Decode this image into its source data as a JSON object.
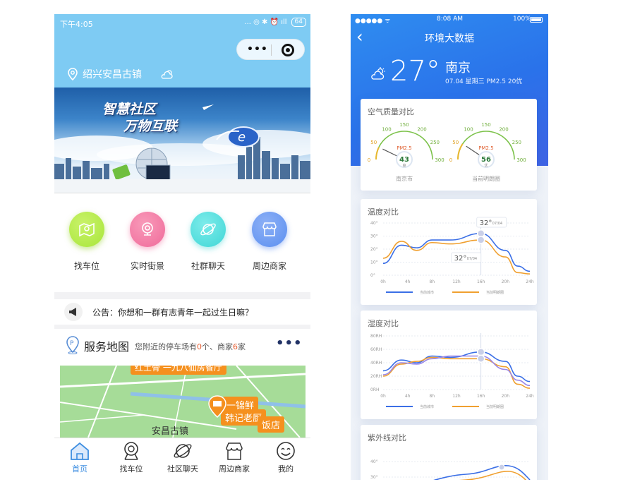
{
  "left": {
    "status": {
      "time": "下午4:05",
      "icons": "... ◎ ✱ ⏰ ıll",
      "battery": "64"
    },
    "location": "绍兴安昌古镇",
    "banner": {
      "line1": "智慧社区",
      "line2": "万物互联"
    },
    "services": [
      {
        "label": "找车位",
        "icon": "map-pin-icon",
        "color": "#a8e63a"
      },
      {
        "label": "实时街景",
        "icon": "camera-icon",
        "color": "#f06a9a"
      },
      {
        "label": "社群聊天",
        "icon": "planet-icon",
        "color": "#3fd7d6"
      },
      {
        "label": "周边商家",
        "icon": "shop-icon",
        "color": "#5b8ff0"
      }
    ],
    "notice": "公告：你想和一群有志青年一起过生日嘛？",
    "map_section": {
      "title": "服务地图",
      "sub_prefix": "您附近的停车场有",
      "parking_count": "0",
      "sub_mid": "个、商家",
      "shop_count": "6",
      "sub_suffix": "家",
      "labels": [
        "红土骨 一九八仙房餐厅",
        "一锦鲜",
        "韩记老厨",
        "饭店"
      ],
      "town": "安昌古镇"
    },
    "tabs": [
      {
        "label": "首页",
        "icon": "home-icon",
        "active": true
      },
      {
        "label": "找车位",
        "icon": "parking-icon",
        "active": false
      },
      {
        "label": "社区聊天",
        "icon": "planet-icon",
        "active": false
      },
      {
        "label": "周边商家",
        "icon": "shop-icon",
        "active": false
      },
      {
        "label": "我的",
        "icon": "smile-icon",
        "active": false
      }
    ]
  },
  "right": {
    "status": {
      "signal": "●●●●● ᯤ",
      "time": "8:08 AM",
      "battery": "100%"
    },
    "title": "环境大数据",
    "temperature": "27°",
    "city": "南京",
    "meta": "07.04  星期三  PM2.5 20优",
    "colors": {
      "blue_line": "#3b6fe6",
      "orange_line": "#f0a030",
      "green_line": "#3fb34f",
      "accent": "#2f7ef0"
    }
  },
  "chart_data": [
    {
      "type": "gauge",
      "title": "空气质量对比",
      "scale_ticks": [
        "0",
        "50",
        "100",
        "150",
        "200",
        "250",
        "300"
      ],
      "range": [
        0,
        300
      ],
      "gauges": [
        {
          "metric": "PM2.5",
          "value": 43,
          "grade": "良",
          "name": "南京市"
        },
        {
          "metric": "PM2.5",
          "value": 56,
          "grade": "优",
          "name": "当前明朗圈"
        }
      ]
    },
    {
      "type": "line",
      "title": "温度对比",
      "x": [
        "0h",
        "4h",
        "8h",
        "12h",
        "16h",
        "20h",
        "24h"
      ],
      "y_ticks": [
        "0°",
        "10°",
        "20°",
        "30°",
        "40°"
      ],
      "ylim": [
        0,
        40
      ],
      "series": [
        {
          "name": "当前城市",
          "values": [
            9,
            23,
            21,
            27,
            27,
            32,
            19,
            7,
            3
          ]
        },
        {
          "name": "当前明朗圈",
          "values": [
            13,
            26,
            19,
            25,
            24,
            27,
            14,
            2,
            1
          ]
        }
      ],
      "x_samples": [
        0,
        3,
        5.5,
        8,
        11,
        16,
        20,
        22,
        24
      ],
      "annotations": [
        {
          "text": "32°",
          "sub": "07/04"
        },
        {
          "text": "32°",
          "sub": "07/04"
        }
      ]
    },
    {
      "type": "line",
      "title": "湿度对比",
      "x": [
        "0h",
        "4h",
        "8h",
        "12h",
        "16h",
        "20h",
        "24h"
      ],
      "y_ticks": [
        "0RH",
        "20RH",
        "40RH",
        "60RH",
        "80RH"
      ],
      "ylim": [
        0,
        80
      ],
      "series": [
        {
          "name": "当前城市",
          "values": [
            28,
            44,
            40,
            50,
            48,
            56,
            42,
            20,
            12
          ]
        },
        {
          "name": "当前明朗圈",
          "values": [
            20,
            38,
            42,
            48,
            46,
            46,
            34,
            8,
            2
          ]
        },
        {
          "name": "",
          "values": [
            22,
            40,
            38,
            46,
            50,
            50,
            30,
            14,
            6
          ]
        }
      ],
      "x_samples": [
        0,
        3,
        5.5,
        8,
        11,
        16,
        20,
        22,
        24
      ]
    },
    {
      "type": "line",
      "title": "紫外线对比",
      "x": [],
      "y_ticks": [
        "40°",
        "30°"
      ],
      "ylim": [
        0,
        40
      ],
      "series": []
    }
  ]
}
